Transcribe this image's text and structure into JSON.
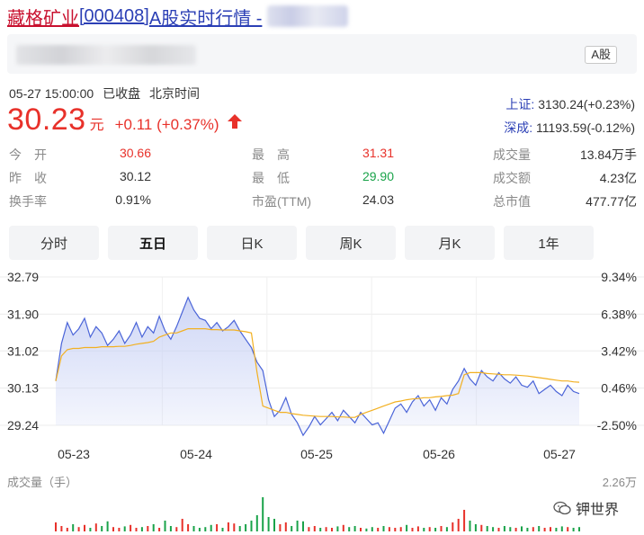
{
  "title": {
    "name": "藏格矿业",
    "code": "[000408]",
    "rest": "A股实时行情 -"
  },
  "banner": {
    "tag": "A股"
  },
  "status": {
    "time": "05-27 15:00:00",
    "state": "已收盘",
    "zone": "北京时间"
  },
  "indices": [
    {
      "name": "上证:",
      "value": "3130.24(+0.23%)"
    },
    {
      "name": "深成:",
      "value": "11193.59(-0.12%)"
    }
  ],
  "quote": {
    "price": "30.23",
    "unit": "元",
    "change": "+0.11 (+0.37%)",
    "color_up": "#e8312a",
    "color_down": "#1aa34a"
  },
  "stats": {
    "open_label": "今　开",
    "open": "30.66",
    "prev_label": "昨　收",
    "prev": "30.12",
    "turnover_label": "换手率",
    "turnover": "0.91%",
    "high_label": "最　高",
    "high": "31.31",
    "low_label": "最　低",
    "low": "29.90",
    "pe_label": "市盈(TTM)",
    "pe": "24.03",
    "volume_label": "成交量",
    "volume": "13.84万手",
    "amount_label": "成交额",
    "amount": "4.23亿",
    "mcap_label": "总市值",
    "mcap": "477.77亿"
  },
  "tabs": [
    {
      "label": "分时",
      "active": false
    },
    {
      "label": "五日",
      "active": true
    },
    {
      "label": "日K",
      "active": false
    },
    {
      "label": "周K",
      "active": false
    },
    {
      "label": "月K",
      "active": false
    },
    {
      "label": "1年",
      "active": false
    }
  ],
  "watermark": {
    "text": "钾世界"
  },
  "chart_data": {
    "type": "line",
    "x_ticks": [
      "05-23",
      "05-24",
      "05-25",
      "05-26",
      "05-27"
    ],
    "y_ticks": [
      "32.79",
      "31.90",
      "31.02",
      "30.13",
      "29.24"
    ],
    "y_ticks_right": [
      "9.34%",
      "6.38%",
      "3.42%",
      "0.46%",
      "-2.50%"
    ],
    "ylim": [
      29.24,
      32.79
    ],
    "line_color": "#4a64d8",
    "avg_color": "#f2b021",
    "area_color": "#c9d2f5",
    "volume_label": "成交量（手）",
    "volume_max_label": "2.26万",
    "price": [
      30.3,
      31.2,
      31.7,
      31.4,
      31.55,
      31.8,
      31.35,
      31.6,
      31.45,
      31.15,
      31.3,
      31.5,
      31.2,
      31.4,
      31.7,
      31.35,
      31.6,
      31.45,
      31.85,
      31.5,
      31.3,
      31.6,
      31.95,
      32.3,
      32.0,
      31.8,
      31.75,
      31.55,
      31.7,
      31.5,
      31.6,
      31.75,
      31.5,
      31.3,
      31.1,
      30.75,
      30.55,
      29.85,
      29.45,
      29.6,
      29.9,
      29.5,
      29.3,
      29.0,
      29.2,
      29.45,
      29.25,
      29.4,
      29.55,
      29.35,
      29.6,
      29.45,
      29.3,
      29.55,
      29.4,
      29.25,
      29.3,
      29.05,
      29.35,
      29.65,
      29.75,
      29.55,
      29.8,
      29.95,
      29.7,
      29.85,
      29.6,
      29.9,
      29.75,
      30.1,
      30.3,
      30.6,
      30.35,
      30.2,
      30.55,
      30.4,
      30.3,
      30.5,
      30.35,
      30.25,
      30.4,
      30.2,
      30.15,
      30.3,
      30.0,
      30.1,
      30.2,
      30.05,
      29.95,
      30.2,
      30.05,
      30.0
    ],
    "avg": [
      30.3,
      30.9,
      31.05,
      31.08,
      31.08,
      31.1,
      31.1,
      31.1,
      31.12,
      31.12,
      31.12,
      31.13,
      31.13,
      31.15,
      31.18,
      31.2,
      31.22,
      31.25,
      31.35,
      31.4,
      31.45,
      31.45,
      31.5,
      31.55,
      31.55,
      31.55,
      31.55,
      31.53,
      31.53,
      31.52,
      31.52,
      31.52,
      31.5,
      31.48,
      31.45,
      30.5,
      29.7,
      29.65,
      29.6,
      29.55,
      29.55,
      29.52,
      29.5,
      29.48,
      29.47,
      29.46,
      29.45,
      29.45,
      29.45,
      29.44,
      29.44,
      29.43,
      29.43,
      29.5,
      29.55,
      29.6,
      29.65,
      29.7,
      29.75,
      29.8,
      29.82,
      29.85,
      29.87,
      29.88,
      29.9,
      29.9,
      29.92,
      29.93,
      29.95,
      29.96,
      30.0,
      30.45,
      30.5,
      30.5,
      30.5,
      30.48,
      30.47,
      30.46,
      30.45,
      30.45,
      30.44,
      30.43,
      30.42,
      30.4,
      30.38,
      30.36,
      30.34,
      30.32,
      30.3,
      30.3,
      30.28,
      30.27
    ],
    "volume": [
      0.25,
      0.15,
      0.1,
      0.2,
      0.12,
      0.18,
      0.1,
      0.22,
      0.15,
      0.28,
      0.12,
      0.1,
      0.14,
      0.18,
      0.1,
      0.12,
      0.15,
      0.2,
      0.1,
      0.3,
      0.15,
      0.12,
      0.35,
      0.2,
      0.15,
      0.1,
      0.12,
      0.18,
      0.2,
      0.1,
      0.25,
      0.22,
      0.15,
      0.2,
      0.3,
      0.45,
      0.95,
      0.4,
      0.35,
      0.2,
      0.25,
      0.15,
      0.3,
      0.28,
      0.12,
      0.15,
      0.1,
      0.12,
      0.1,
      0.14,
      0.18,
      0.12,
      0.15,
      0.1,
      0.08,
      0.12,
      0.1,
      0.15,
      0.12,
      0.1,
      0.12,
      0.18,
      0.1,
      0.14,
      0.1,
      0.12,
      0.1,
      0.15,
      0.12,
      0.25,
      0.35,
      0.6,
      0.3,
      0.2,
      0.18,
      0.15,
      0.12,
      0.1,
      0.15,
      0.12,
      0.1,
      0.14,
      0.1,
      0.12,
      0.15,
      0.1,
      0.12,
      0.1,
      0.14,
      0.12,
      0.1,
      0.12
    ]
  }
}
